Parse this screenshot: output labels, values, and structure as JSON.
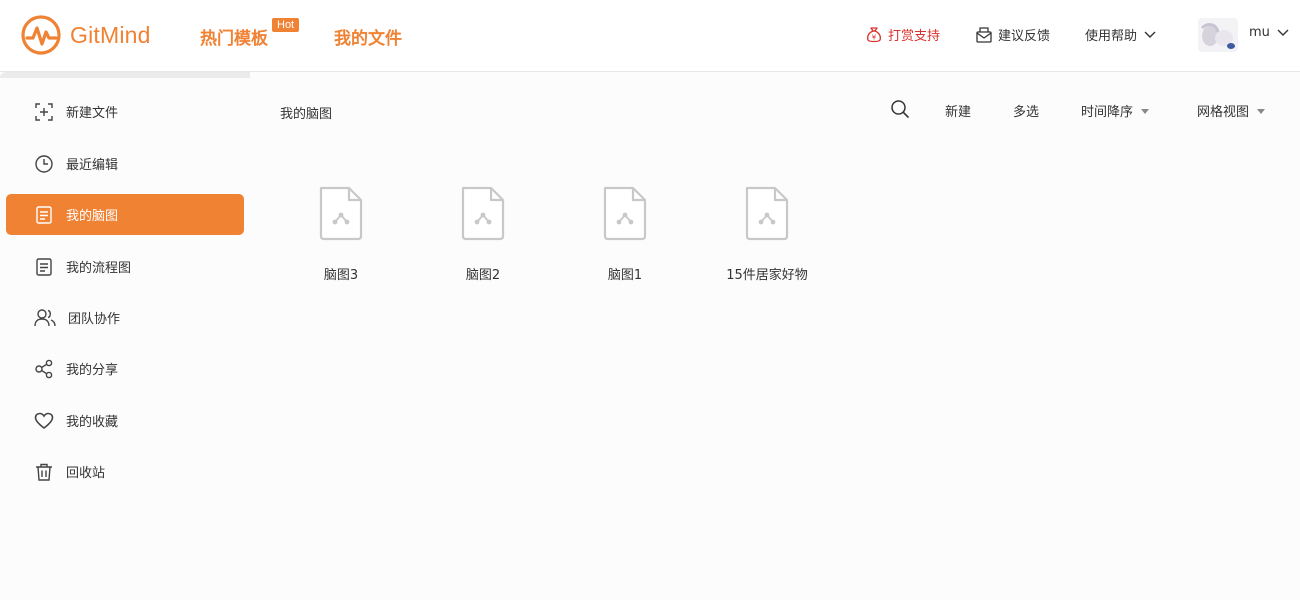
{
  "app": {
    "logo_text": "GitMind"
  },
  "nav": {
    "templates": "热门模板",
    "hot_badge": "Hot",
    "my_files": "我的文件"
  },
  "header_right": {
    "donate": "打赏支持",
    "feedback": "建议反馈",
    "help": "使用帮助",
    "username": "mu"
  },
  "sidebar": {
    "items": [
      {
        "label": "新建文件",
        "icon": "new-file-icon"
      },
      {
        "label": "最近编辑",
        "icon": "clock-icon"
      },
      {
        "label": "我的脑图",
        "icon": "document-icon",
        "active": true
      },
      {
        "label": "我的流程图",
        "icon": "document-icon"
      },
      {
        "label": "团队协作",
        "icon": "team-icon"
      },
      {
        "label": "我的分享",
        "icon": "share-icon"
      },
      {
        "label": "我的收藏",
        "icon": "heart-icon"
      },
      {
        "label": "回收站",
        "icon": "trash-icon"
      }
    ]
  },
  "main": {
    "breadcrumb": "我的脑图",
    "toolbar": {
      "new": "新建",
      "multi_select": "多选",
      "sort": "时间降序",
      "view": "网格视图"
    },
    "files": [
      {
        "name": "脑图3"
      },
      {
        "name": "脑图2"
      },
      {
        "name": "脑图1"
      },
      {
        "name": "15件居家好物"
      }
    ]
  },
  "colors": {
    "accent": "#f08234",
    "donate": "#d9312b"
  }
}
